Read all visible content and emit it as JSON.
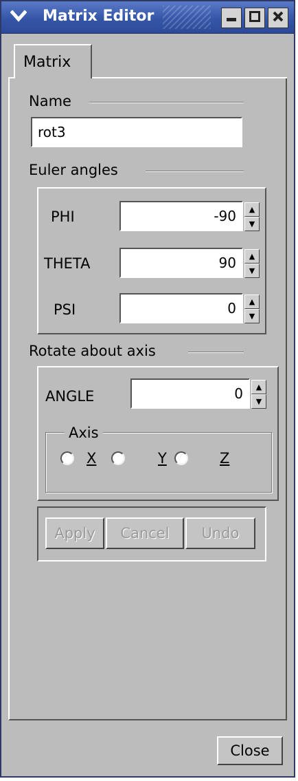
{
  "window": {
    "title": "Matrix Editor"
  },
  "tabs": [
    {
      "label": "Matrix"
    }
  ],
  "name_section": {
    "label": "Name",
    "value": "rot3"
  },
  "euler_section": {
    "label": "Euler angles",
    "fields": [
      {
        "label": "PHI",
        "value": "-90"
      },
      {
        "label": "THETA",
        "value": "90"
      },
      {
        "label": "PSI",
        "value": "0"
      }
    ]
  },
  "rotate_section": {
    "label": "Rotate about axis",
    "angle_label": "ANGLE",
    "angle_value": "0",
    "axis_group_label": "Axis",
    "axis_options": [
      {
        "label": "X",
        "selected": false
      },
      {
        "label": "Y",
        "selected": false
      },
      {
        "label": "Z",
        "selected": false
      }
    ]
  },
  "actions": {
    "apply_label": "Apply",
    "cancel_label": "Cancel",
    "undo_label": "Undo"
  },
  "footer": {
    "close_label": "Close"
  }
}
